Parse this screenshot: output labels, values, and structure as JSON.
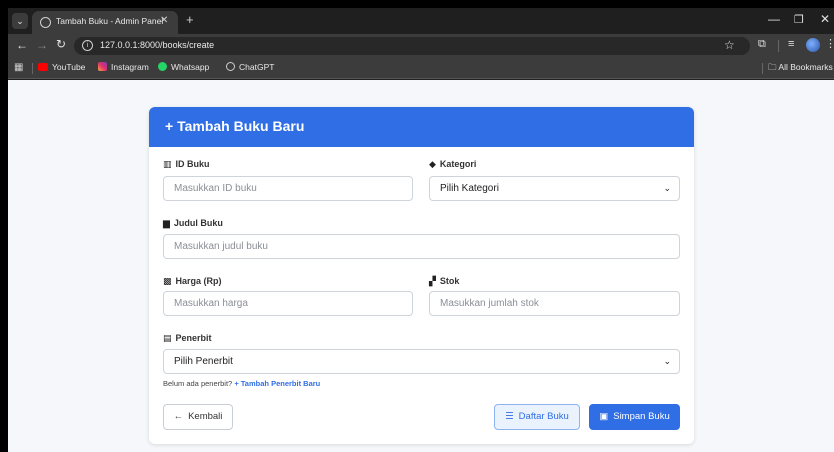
{
  "browser": {
    "tab_title": "Tambah Buku - Admin Panel",
    "url": "127.0.0.1:8000/books/create",
    "bookmarks": [
      "YouTube",
      "Instagram",
      "Whatsapp",
      "ChatGPT"
    ],
    "all_bookmarks": "All Bookmarks"
  },
  "card": {
    "title": "Tambah Buku Baru"
  },
  "form": {
    "id_label": "ID Buku",
    "id_placeholder": "Masukkan ID buku",
    "kategori_label": "Kategori",
    "kategori_value": "Pilih Kategori",
    "judul_label": "Judul Buku",
    "judul_placeholder": "Masukkan judul buku",
    "harga_label": "Harga (Rp)",
    "harga_placeholder": "Masukkan harga",
    "stok_label": "Stok",
    "stok_placeholder": "Masukkan jumlah stok",
    "penerbit_label": "Penerbit",
    "penerbit_value": "Pilih Penerbit",
    "hint_text": "Belum ada penerbit?",
    "hint_link": "Tambah Penerbit Baru"
  },
  "buttons": {
    "back": "Kembali",
    "list": "Daftar Buku",
    "save": "Simpan Buku"
  },
  "colors": {
    "primary": "#2f6ee5"
  }
}
